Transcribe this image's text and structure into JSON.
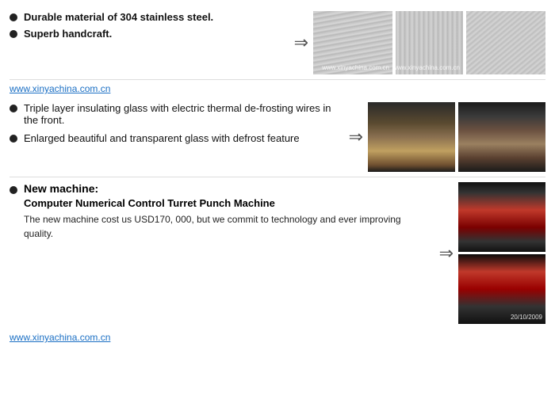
{
  "sections": [
    {
      "id": "steel",
      "bullets": [
        {
          "text": "Durable material of 304 stainless steel.",
          "bold": true
        },
        {
          "text": "Superb handcraft.",
          "bold": true
        }
      ],
      "link": "www.xinyachina.com.cn",
      "images": [
        {
          "id": "steel-1",
          "watermark": "www.xinyachina.com.cn"
        },
        {
          "id": "steel-2",
          "watermark": "www.xinyachina.com.cn"
        },
        {
          "id": "steel-3",
          "watermark": ""
        }
      ]
    },
    {
      "id": "glass",
      "bullets": [
        {
          "text": "Triple layer insulating glass with electric thermal de-frosting wires in the front.",
          "bold": false
        },
        {
          "text": "Enlarged beautiful and transparent glass with defrost feature",
          "bold": false
        }
      ],
      "images": [
        {
          "id": "display-1",
          "watermark": ""
        },
        {
          "id": "display-2",
          "watermark": ""
        }
      ]
    },
    {
      "id": "machine",
      "new_machine_label": "New machine:",
      "subtitle": "Computer Numerical Control Turret Punch Machine",
      "body": "The new machine cost us USD170, 000, but we commit to technology and ever improving quality.",
      "link": "www.xinyachina.com.cn",
      "images": [
        {
          "id": "machine-1",
          "watermark": "20/10/2009"
        },
        {
          "id": "machine-2",
          "watermark": ""
        }
      ]
    }
  ],
  "arrow_symbol": "⇒"
}
